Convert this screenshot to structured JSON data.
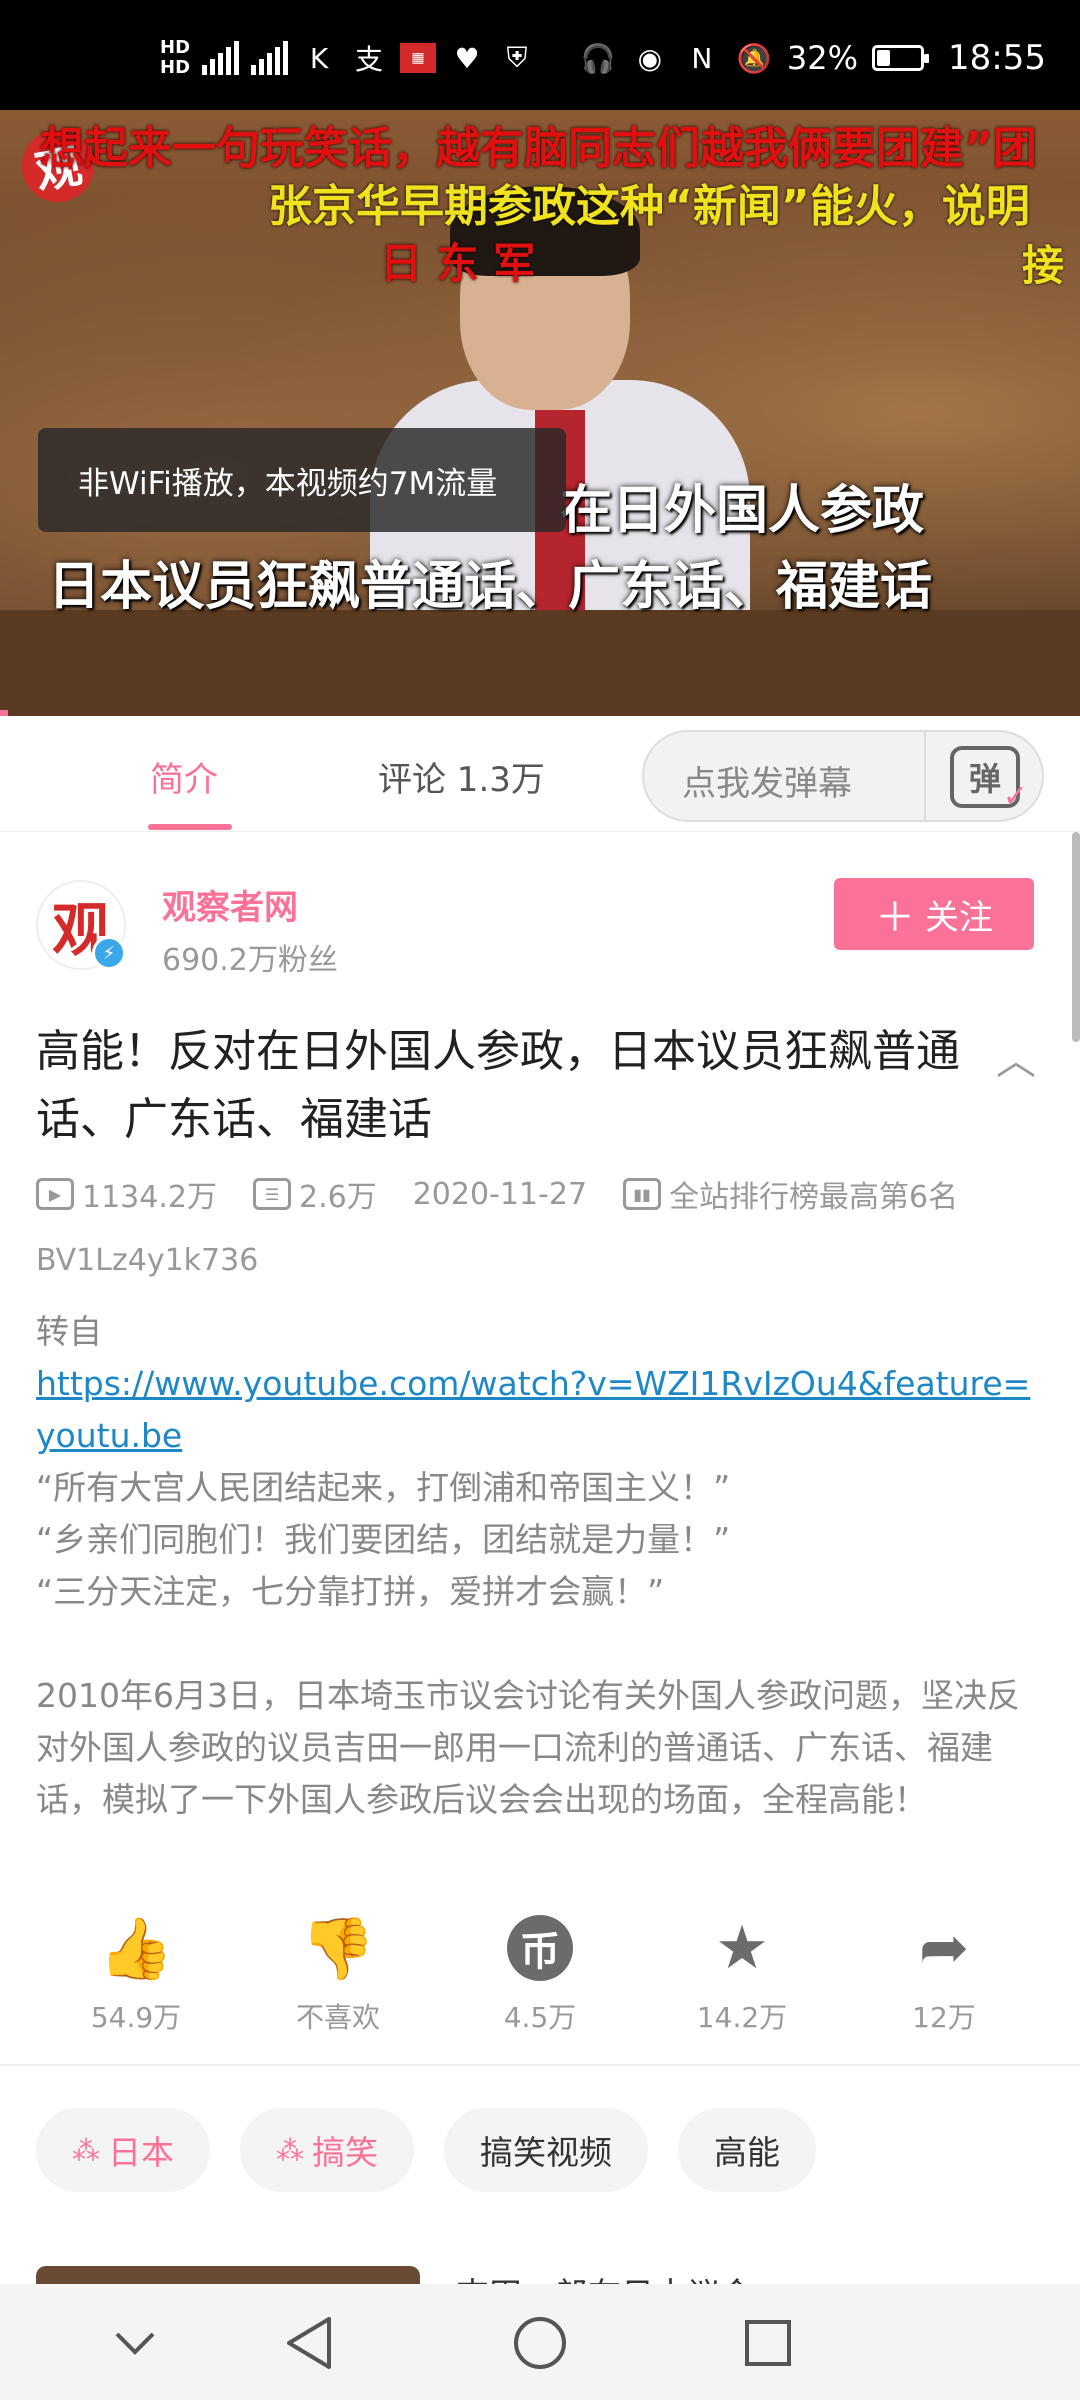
{
  "status_bar": {
    "network_left": "HD 4G 4G",
    "battery": "32%",
    "battery_level": 0.32,
    "time": "18:55",
    "icons": [
      "hd-icon",
      "signal-icon",
      "k-app-icon",
      "alipay-icon",
      "news-icon",
      "health-icon",
      "shield-icon",
      "headset-icon",
      "eye-icon",
      "nfc-icon",
      "mute-icon",
      "battery-icon"
    ]
  },
  "video": {
    "logo_text": "观",
    "caption_line1": "想起来一句玩笑话，越有脑同志们越我俩要团建”团",
    "caption_line2": "张京华早期参政这种“新闻”能火，说明",
    "caption_line3": "日      东 军",
    "caption_line3b": "接",
    "toast": "非WiFi播放，本视频约7M流量",
    "subtitle1": "在日外国人参政",
    "subtitle2": "日本议员狂飙普通话、广东话、福建话"
  },
  "tabs": {
    "intro": "简介",
    "comments": "评论 1.3万",
    "danmaku_placeholder": "点我发弹幕",
    "danmaku_icon": "弹"
  },
  "uploader": {
    "avatar_text": "观",
    "name": "观察者网",
    "fans": "690.2万粉丝",
    "follow_label": "关注"
  },
  "video_info": {
    "title": "高能！反对在日外国人参政，日本议员狂飙普通话、广东话、福建话",
    "views": "1134.2万",
    "danmaku_count": "2.6万",
    "date": "2020-11-27",
    "rank": "全站排行榜最高第6名",
    "bvid": "BV1Lz4y1k736"
  },
  "description": {
    "repost_label": "转自",
    "link": "https://www.youtube.com/watch?v=WZI1RvIzOu4&feature=youtu.be",
    "quote1": "“所有大宫人民团结起来，打倒浦和帝国主义！”",
    "quote2": "“乡亲们同胞们！我们要团结，团结就是力量！”",
    "quote3": "“三分天注定，七分靠打拼，爱拼才会赢！”",
    "paragraph": " 2010年6月3日，日本埼玉市议会讨论有关外国人参政问题，坚决反对外国人参政的议员吉田一郎用一口流利的普通话、广东话、福建话，模拟了一下外国人参政后议会会出现的场面，全程高能！"
  },
  "actions": {
    "like": "54.9万",
    "dislike": "不喜欢",
    "coin": "4.5万",
    "coin_icon": "币",
    "favorite": "14.2万",
    "share": "12万"
  },
  "tags": [
    "日本",
    "搞笑",
    "搞笑视频",
    "高能"
  ],
  "recommendation": {
    "title": "吉田一郎在日本议会..."
  },
  "colors": {
    "accent": "#fb7299",
    "link": "#1e88c7"
  }
}
